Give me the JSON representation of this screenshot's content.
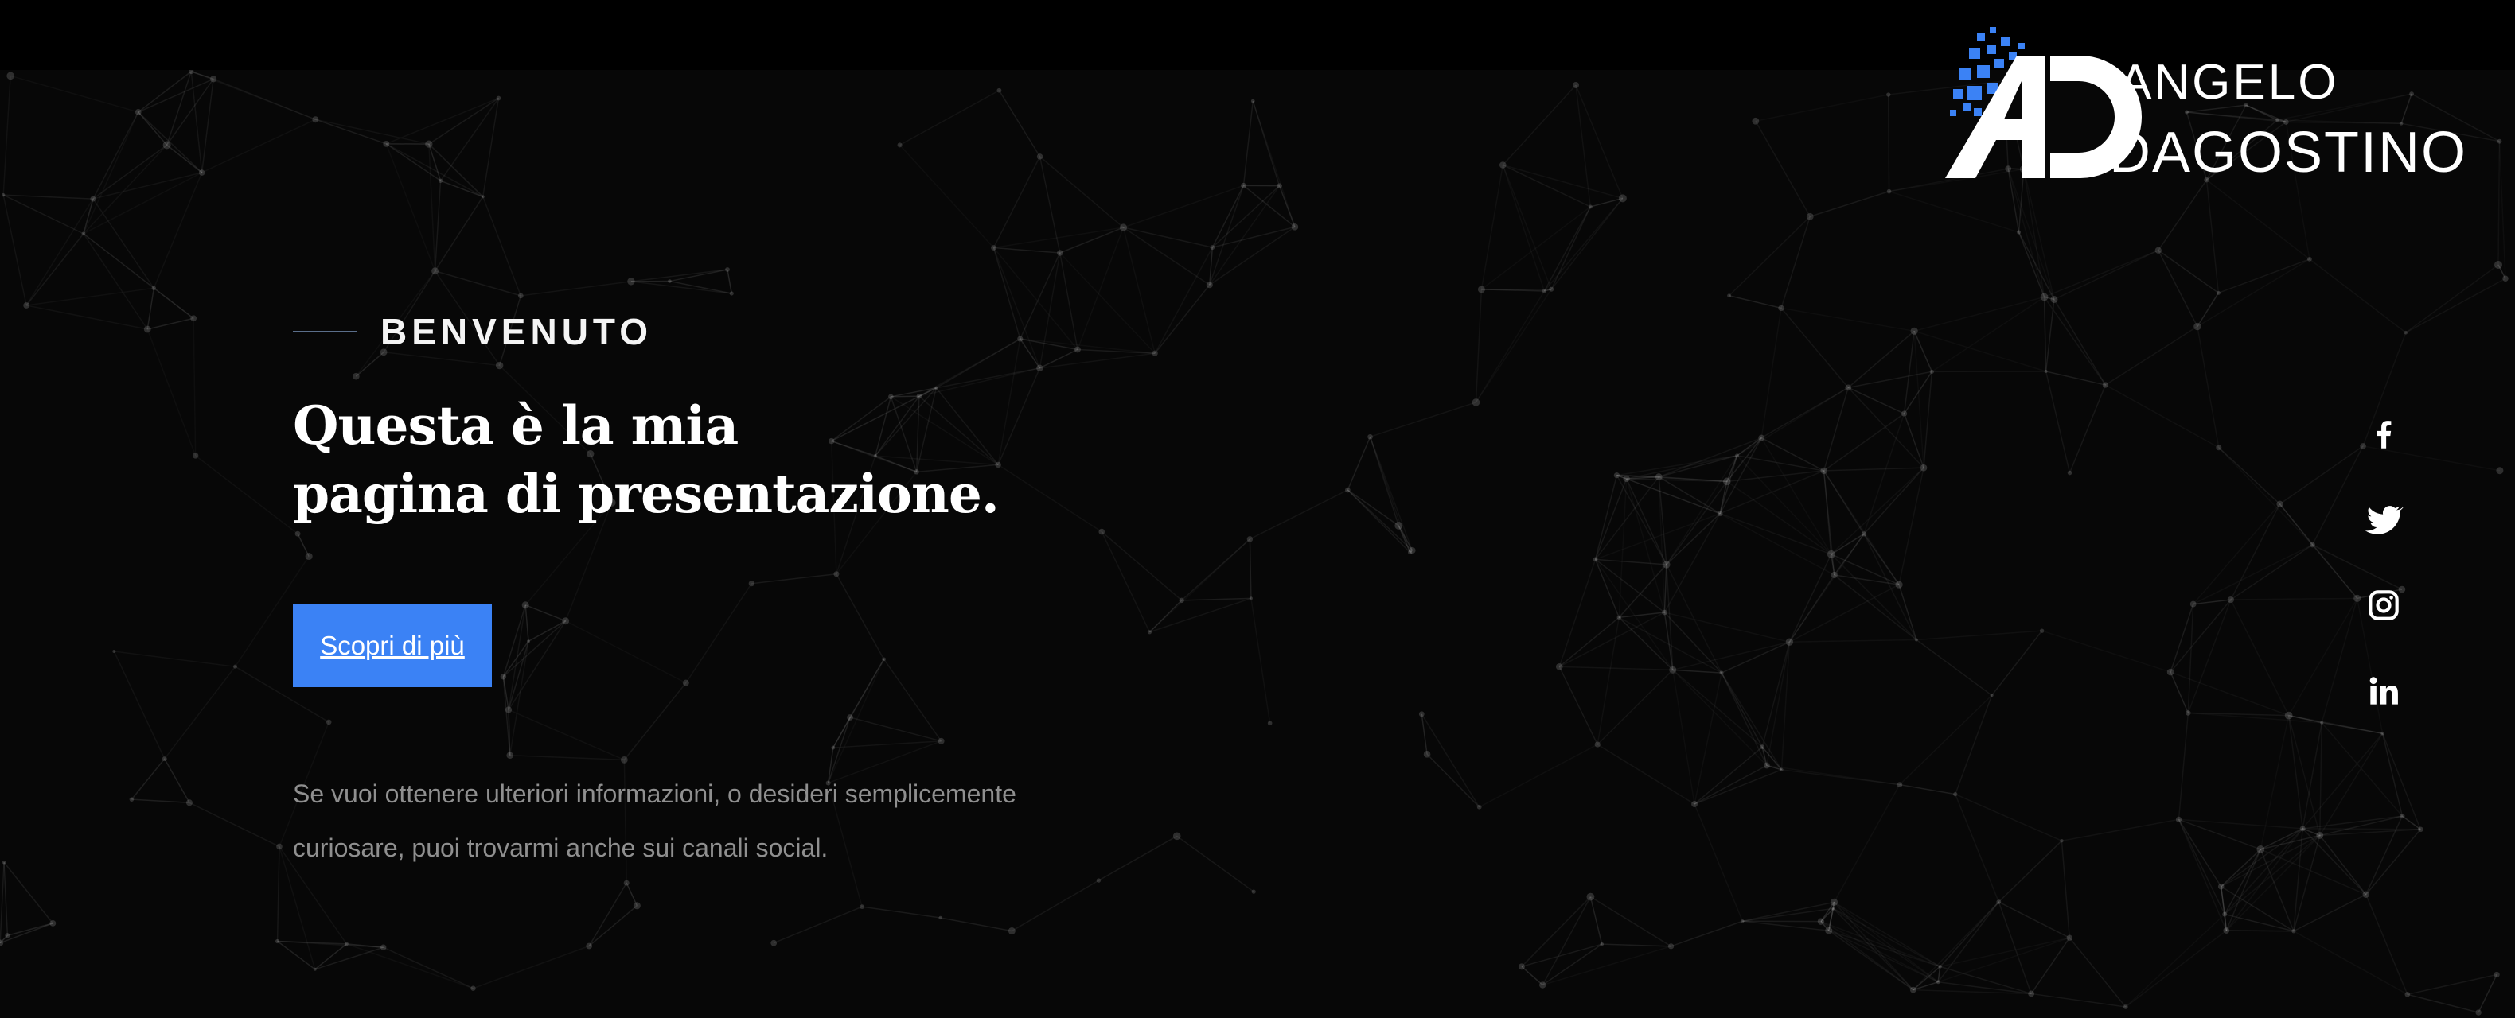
{
  "brand": {
    "logo_text_line1": "ANGELO",
    "logo_text_line2": "DAGOSTINO",
    "monogram": "AD"
  },
  "hero": {
    "eyebrow": "BENVENUTO",
    "headline_line1": "Questa è la mia",
    "headline_line2": "pagina di presentazione.",
    "cta_label": "Scopri di più",
    "description": "Se vuoi ottenere ulteriori informazioni, o desideri semplicemente curiosare, puoi trovarmi anche sui canali social."
  },
  "social": [
    {
      "icon": "facebook-icon"
    },
    {
      "icon": "twitter-icon"
    },
    {
      "icon": "instagram-icon"
    },
    {
      "icon": "linkedin-icon"
    }
  ],
  "colors": {
    "background": "#070707",
    "accent": "#3b82f5",
    "text": "#ffffff",
    "muted_text": "#8f8f8f"
  }
}
